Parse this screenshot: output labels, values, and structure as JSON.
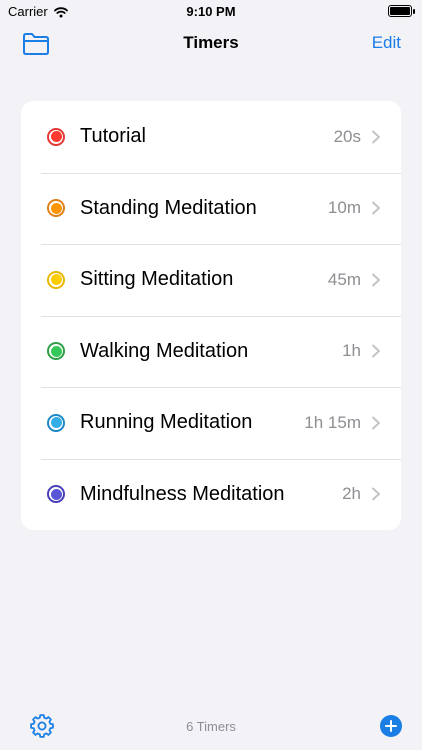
{
  "status_bar": {
    "carrier": "Carrier",
    "time": "9:10 PM"
  },
  "nav": {
    "title": "Timers",
    "edit_label": "Edit"
  },
  "timers": [
    {
      "name": "Tutorial",
      "duration": "20s",
      "color": "#e53935",
      "inner": "#ff3b30"
    },
    {
      "name": "Standing Meditation",
      "duration": "10m",
      "color": "#e0821a",
      "inner": "#ff9500"
    },
    {
      "name": "Sitting Meditation",
      "duration": "45m",
      "color": "#e6b800",
      "inner": "#ffcc00"
    },
    {
      "name": "Walking Meditation",
      "duration": "1h",
      "color": "#2e9e47",
      "inner": "#34c759"
    },
    {
      "name": "Running Meditation",
      "duration": "1h 15m",
      "color": "#1e88c8",
      "inner": "#32ade6"
    },
    {
      "name": "Mindfulness Meditation",
      "duration": "2h",
      "color": "#4a3fb8",
      "inner": "#5856d6"
    }
  ],
  "toolbar": {
    "count_label": "6 Timers"
  },
  "colors": {
    "accent": "#1a7ee5",
    "background": "#f2f2f7",
    "secondary_text": "#8e8e93"
  }
}
